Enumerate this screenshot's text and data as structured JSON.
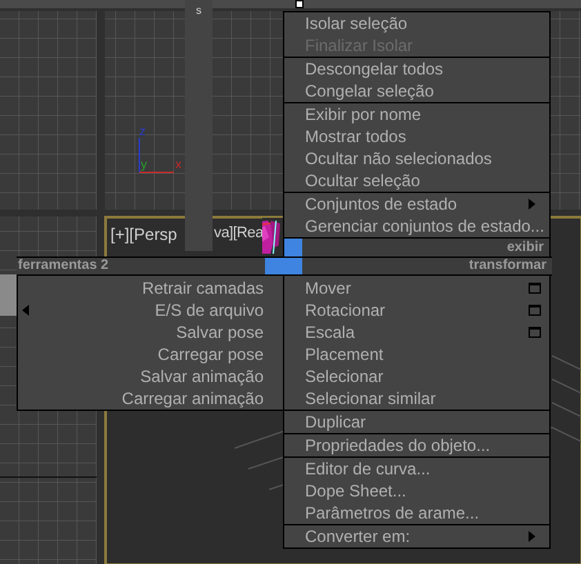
{
  "side_bar": {
    "label": "s"
  },
  "viewport": {
    "label_parts": [
      "[+][Persp",
      "va][Rea"
    ],
    "axes": [
      {
        "label": "z",
        "color": "#2a3cc8"
      },
      {
        "label": "y",
        "color": "#2aa02a"
      },
      {
        "label": "x",
        "color": "#c82a2a"
      }
    ]
  },
  "quad_menu": {
    "upper_right": {
      "title": "exibir",
      "sections": [
        [
          {
            "label": "Isolar seleção",
            "kind": "plain",
            "disabled": false
          },
          {
            "label": "Finalizar Isolar",
            "kind": "plain",
            "disabled": true
          }
        ],
        [
          {
            "label": "Descongelar todos",
            "kind": "plain",
            "disabled": false
          },
          {
            "label": "Congelar seleção",
            "kind": "plain",
            "disabled": false
          }
        ],
        [
          {
            "label": "Exibir por nome",
            "kind": "plain",
            "disabled": false
          },
          {
            "label": "Mostrar todos",
            "kind": "plain",
            "disabled": false
          },
          {
            "label": "Ocultar não selecionados",
            "kind": "plain",
            "disabled": false
          },
          {
            "label": "Ocultar seleção",
            "kind": "plain",
            "disabled": false
          }
        ],
        [
          {
            "label": "Conjuntos de estado",
            "kind": "submenu",
            "disabled": false
          },
          {
            "label": "Gerenciar conjuntos de estado...",
            "kind": "plain",
            "disabled": false
          }
        ]
      ]
    },
    "lower_left": {
      "title": "ferramentas 2",
      "items": [
        {
          "label": "Retrair camadas",
          "kind": "plain",
          "disabled": false
        },
        {
          "label": "E/S de arquivo",
          "kind": "submenu",
          "disabled": false
        },
        {
          "label": "Salvar pose",
          "kind": "plain",
          "disabled": false
        },
        {
          "label": "Carregar pose",
          "kind": "plain",
          "disabled": false
        },
        {
          "label": "Salvar animação",
          "kind": "plain",
          "disabled": false
        },
        {
          "label": "Carregar animação",
          "kind": "plain",
          "disabled": false
        }
      ]
    },
    "lower_right": {
      "title": "transformar",
      "sections": [
        [
          {
            "label": "Mover",
            "kind": "options",
            "disabled": false
          },
          {
            "label": "Rotacionar",
            "kind": "options",
            "disabled": false
          },
          {
            "label": "Escala",
            "kind": "options",
            "disabled": false
          },
          {
            "label": "Placement",
            "kind": "plain",
            "disabled": false
          },
          {
            "label": "Selecionar",
            "kind": "plain",
            "disabled": false
          },
          {
            "label": "Selecionar similar",
            "kind": "plain",
            "disabled": false
          }
        ],
        [
          {
            "label": "Duplicar",
            "kind": "plain",
            "disabled": false
          }
        ],
        [
          {
            "label": "Propriedades do objeto...",
            "kind": "plain",
            "disabled": false
          }
        ],
        [
          {
            "label": "Editor de curva...",
            "kind": "plain",
            "disabled": false
          },
          {
            "label": "Dope Sheet...",
            "kind": "plain",
            "disabled": false
          },
          {
            "label": "Parâmetros de arame...",
            "kind": "plain",
            "disabled": false
          }
        ],
        [
          {
            "label": "Converter em:",
            "kind": "submenu",
            "disabled": false
          }
        ]
      ]
    }
  }
}
